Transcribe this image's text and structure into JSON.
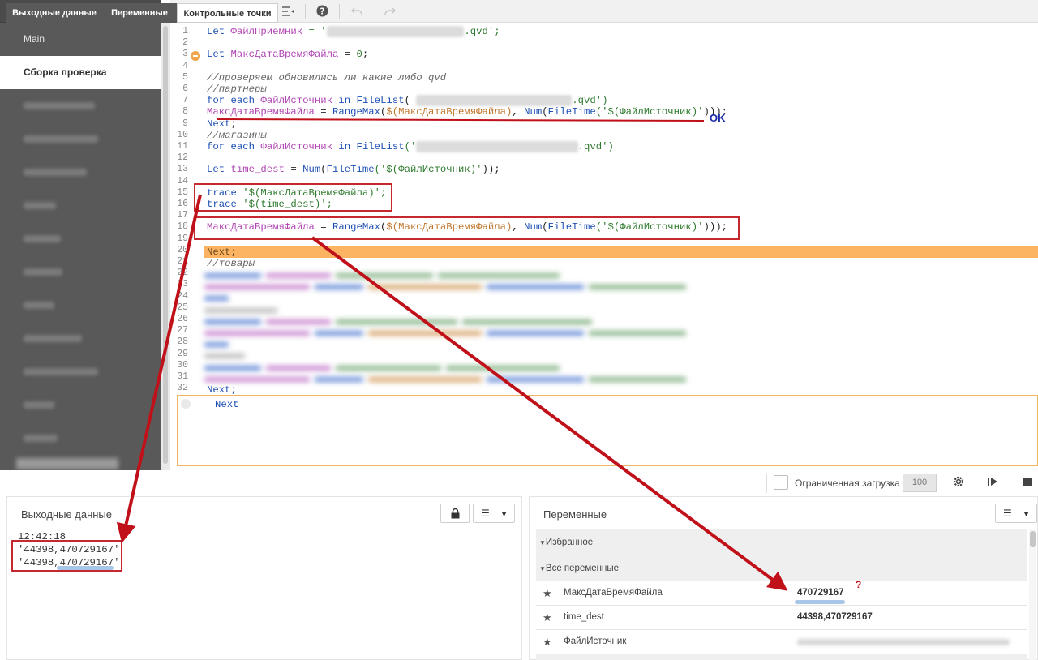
{
  "sidebar": {
    "add_icon": "plus-circle-icon",
    "items": [
      {
        "label": "Main",
        "active": false
      },
      {
        "label": "Сборка проверка",
        "active": true
      }
    ],
    "blurred_item_count": 11
  },
  "toolbar": {
    "icons": [
      "search-icon",
      "comment-icon",
      "indent-icon",
      "outdent-icon",
      "help-icon",
      "undo-icon",
      "redo-icon"
    ]
  },
  "editor": {
    "line_numbers": [
      "1",
      "2",
      "3",
      "4",
      "5",
      "6",
      "7",
      "8",
      "9",
      "10",
      "11",
      "12",
      "13",
      "14",
      "15",
      "16",
      "17",
      "18",
      "19",
      "20",
      "21",
      "22",
      "23",
      "24",
      "25",
      "26",
      "27",
      "28",
      "29",
      "30",
      "31",
      "32"
    ],
    "lines": {
      "l1_kw": "Let",
      "l1_var": "ФайлПриемник",
      "l1_eq": " = '",
      "l1_ext": ".qvd';",
      "l3_kw": "Let",
      "l3_var": "МаксДатаВремяФайла",
      "l3_rest": " = ",
      "l3_num": "0",
      "l3_end": ";",
      "l5": "//проверяем обновились ли какие либо qvd",
      "l6": "//партнеры",
      "l7_kw": "for each",
      "l7_var": "ФайлИсточник",
      "l7_in": "in",
      "l7_fn": "FileList",
      "l7_open": "(",
      "l7_ext": ".qvd')",
      "l8_var": "МаксДатаВремяФайла",
      "l8_eq": " = ",
      "l8_fn1": "RangeMax",
      "l8_p1": "(",
      "l8_var2": "$(МаксДатаВремяФайла)",
      "l8_c": ", ",
      "l8_fn2": "Num",
      "l8_p2": "(",
      "l8_fn3": "FileTime",
      "l8_str": "('$(ФайлИсточник)'",
      "l8_end": ")));",
      "l9": "Next",
      "l9_end": ";",
      "l10": "//магазины",
      "l11_kw": "for each",
      "l11_var": "ФайлИсточник",
      "l11_in": "in",
      "l11_fn": "FileList",
      "l11_open": "('",
      "l11_ext": ".qvd')",
      "l13_kw": "Let",
      "l13_var": "time_dest",
      "l13_eq": " = ",
      "l13_fn1": "Num",
      "l13_p": "(",
      "l13_fn2": "FileTime",
      "l13_str": "('$(ФайлИсточник)'",
      "l13_end": "));",
      "l15_kw": "trace",
      "l15_str": " '$(МаксДатаВремяФайла)';",
      "l16_kw": "trace",
      "l16_str": " '$(time_dest)';",
      "l18_var": "МаксДатаВремяФайла",
      "l18_eq": " = ",
      "l18_fn1": "RangeMax",
      "l18_p1": "(",
      "l18_var2": "$(МаксДатаВремяФайла)",
      "l18_c": ", ",
      "l18_fn2": "Num",
      "l18_p2": "(",
      "l18_fn3": "FileTime",
      "l18_str": "('$(ФайлИсточник)'",
      "l18_end": ")));",
      "l20": "Next",
      "l20_end": ";",
      "l21": "//товары",
      "l32": "Next;"
    },
    "ok_annotation": "OK",
    "next_panel_text": "Next"
  },
  "tabs": [
    {
      "label": "Выходные данные",
      "active": true
    },
    {
      "label": "Переменные",
      "active": true
    },
    {
      "label": "Контрольные точки",
      "active": false
    }
  ],
  "limited_load": {
    "label": "Ограниченная загрузка",
    "value": "100",
    "checked": false
  },
  "output": {
    "title": "Выходные данные",
    "lines": [
      "12:42:18",
      "'44398,470729167'",
      "'44398,470729167'"
    ]
  },
  "variables": {
    "title": "Переменные",
    "groups": {
      "favorites": "Избранное",
      "all": "Все переменные"
    },
    "rows": [
      {
        "name": "МаксДатаВремяФайла",
        "value": "470729167"
      },
      {
        "name": "time_dest",
        "value": "44398,470729167"
      },
      {
        "name": "ФайлИсточник",
        "value": ""
      }
    ],
    "question_mark": "?"
  },
  "colors": {
    "highlight_line": "#fcb462",
    "annotation_red": "#c0111a",
    "annotation_blue": "#1a2aa8",
    "sidebar_bg": "#595959"
  }
}
